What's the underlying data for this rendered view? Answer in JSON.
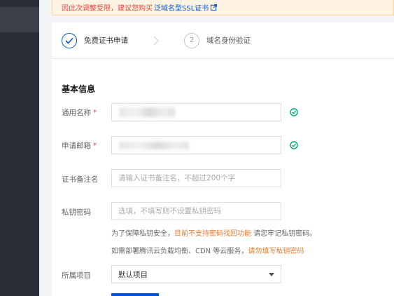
{
  "notice": {
    "text": "因此次调整受限，建议您购买",
    "link": "泛域名型SSL证书",
    "link_icon": "external-link-icon"
  },
  "steps": [
    {
      "label": "免费证书申请",
      "state": "done",
      "icon": "check-icon"
    },
    {
      "label": "域名身份验证",
      "state": "todo",
      "number": "2"
    }
  ],
  "form": {
    "section_title": "基本信息",
    "common_name": {
      "label": "通用名称",
      "required": "*",
      "value": "",
      "status_icon": "check-circle-icon"
    },
    "email": {
      "label": "申请邮箱",
      "required": "*",
      "value": "",
      "status_icon": "check-circle-icon"
    },
    "remark": {
      "label": "证书备注名",
      "placeholder": "请输入证书备注名，不超过200个字"
    },
    "private_key": {
      "label": "私钥密码",
      "placeholder": "选填，不填写则不设置私钥密码",
      "hint1_prefix": "为了保障私钥安全，",
      "hint1_warn": "目前不支持密码找回功能",
      "hint1_suffix": " 请您牢记私钥密码。",
      "hint2_prefix": "如需部署腾讯云负载均衡、CDN 等云服务，",
      "hint2_warn": "请勿填写私钥密码"
    },
    "project": {
      "label": "所属项目",
      "selected": "默认项目"
    }
  },
  "colors": {
    "primary": "#0052d9",
    "success": "#00a870",
    "warning": "#ed7b2f",
    "error": "#e54545",
    "sidebar": "#292d37"
  }
}
